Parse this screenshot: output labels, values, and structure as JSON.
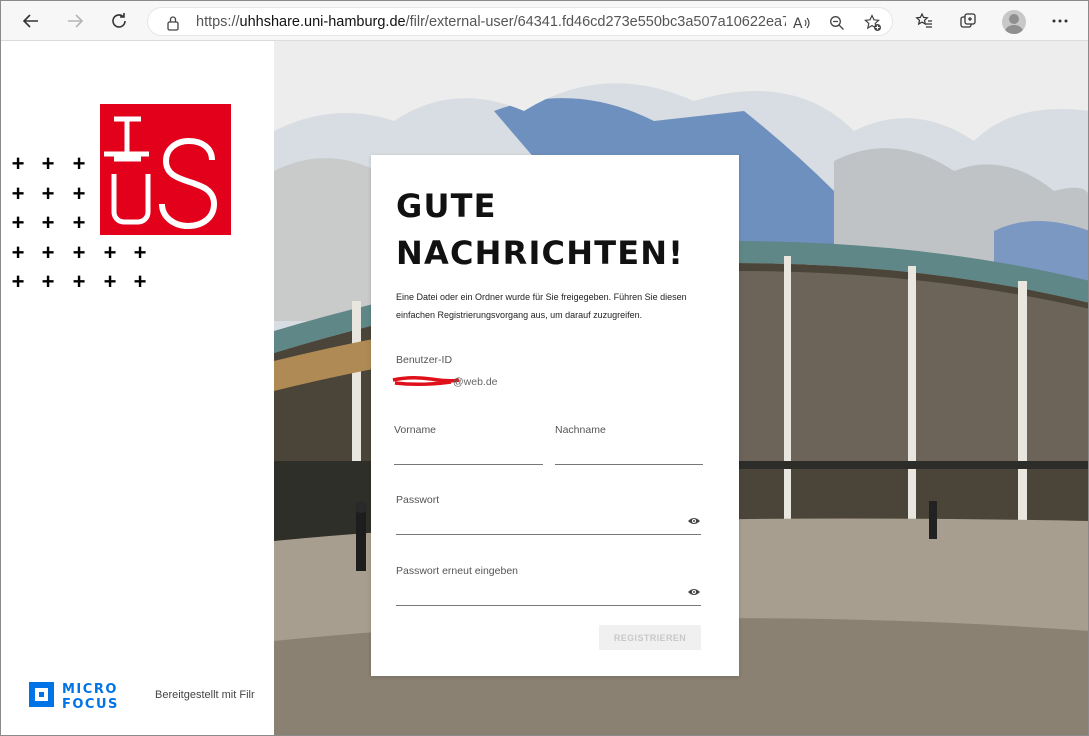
{
  "browser": {
    "url_prefix": "https://",
    "url_host": "uhhshare.uni-hamburg.de",
    "url_path": "/filr/external-user/64341.fd46cd273e550bc3a507a10622ea7..."
  },
  "brand": {
    "accent_color": "#e2001a",
    "provided_by": "Bereitgestellt mit Filr",
    "microfocus_line1": "MICRO",
    "microfocus_line2": "FOCUS",
    "microfocus_color": "#0073e7"
  },
  "card": {
    "title_line1": "GUTE",
    "title_line2": "NACHRICHTEN!",
    "description": "Eine Datei oder ein Ordner wurde für Sie freigegeben. Führen Sie diesen einfachen Registrierungsvorgang aus, um darauf zuzugreifen.",
    "userid_label": "Benutzer-ID",
    "userid_value": "@web.de",
    "firstname_label": "Vorname",
    "lastname_label": "Nachname",
    "password_label": "Passwort",
    "password_confirm_label": "Passwort erneut eingeben",
    "register_label": "REGISTRIEREN"
  }
}
